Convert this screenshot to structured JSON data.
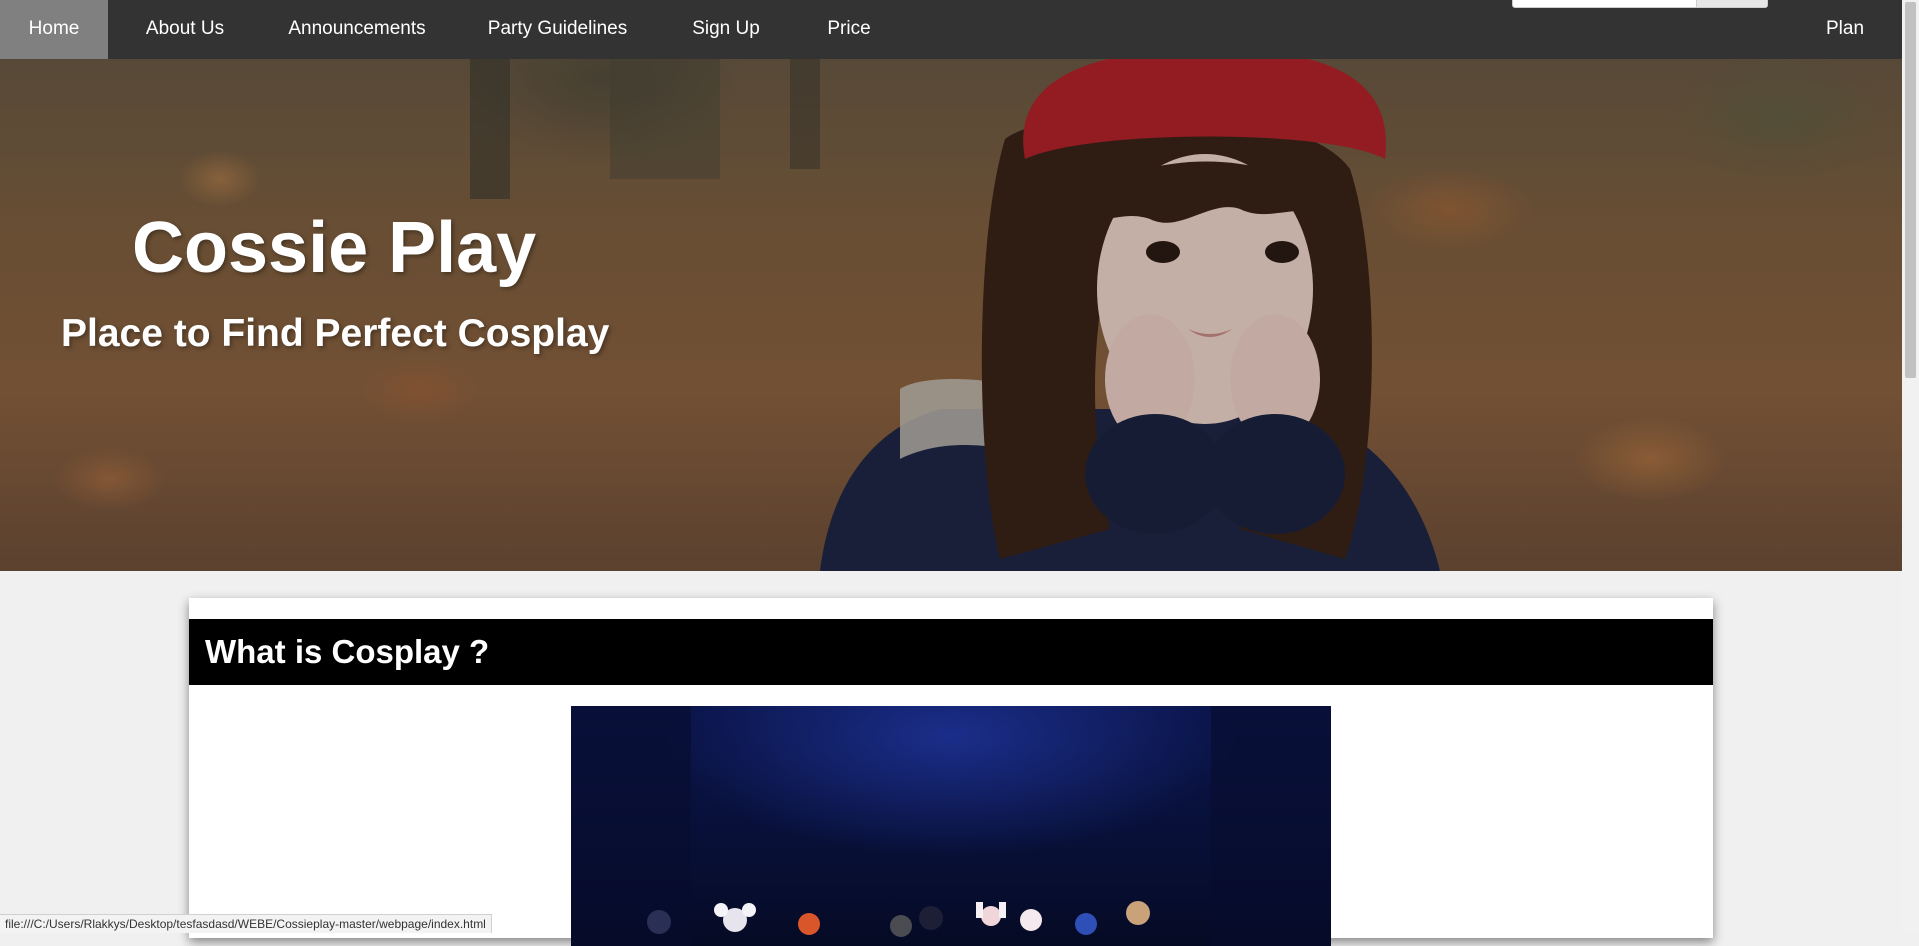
{
  "nav": {
    "items": [
      {
        "label": "Home",
        "active": true
      },
      {
        "label": "About Us"
      },
      {
        "label": "Announcements"
      },
      {
        "label": "Party Guidelines"
      },
      {
        "label": "Sign Up"
      },
      {
        "label": "Price"
      }
    ],
    "right_item": {
      "label": "Plan"
    }
  },
  "hero": {
    "title": "Cossie Play",
    "subtitle": "Place to Find Perfect Cosplay"
  },
  "section": {
    "title": "What is Cosplay ?"
  },
  "status_bar": {
    "url": "file:///C:/Users/Rlakkys/Desktop/tesfasdasd/WEBE/Cossieplay-master/webpage/index.html"
  },
  "colors": {
    "nav_bg": "#333333",
    "nav_active": "#808080",
    "section_header_bg": "#000000",
    "page_bg": "#f0f0f0"
  }
}
